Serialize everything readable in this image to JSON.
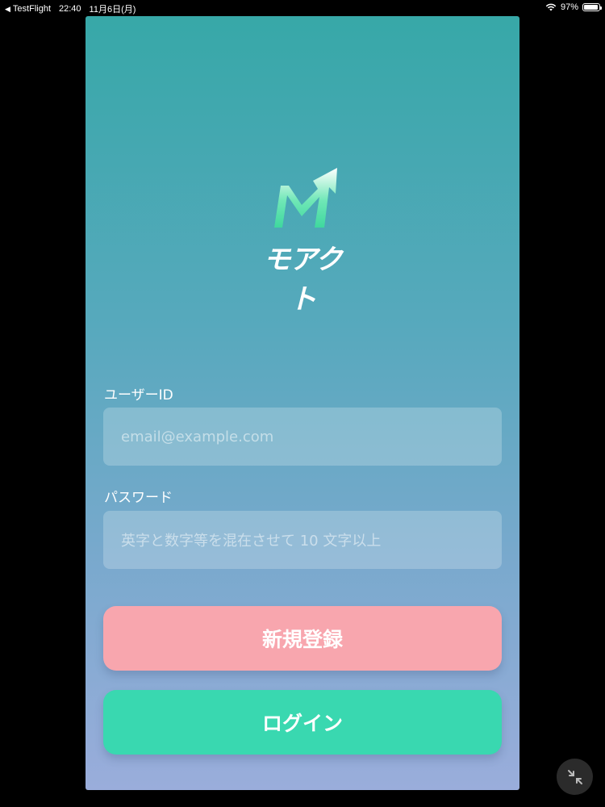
{
  "status_bar": {
    "back_app": "TestFlight",
    "time": "22:40",
    "date": "11月6日(月)",
    "battery": "97%",
    "battery_level": 0.97
  },
  "app": {
    "logo_text": "モアクト",
    "user_id": {
      "label": "ユーザーID",
      "placeholder": "email@example.com"
    },
    "password": {
      "label": "パスワード",
      "placeholder": "英字と数字等を混在させて 10 文字以上"
    },
    "register_button": "新規登録",
    "login_button": "ログイン"
  },
  "colors": {
    "gradient_top": "#37a8a8",
    "gradient_bottom": "#9aaddb",
    "register": "#f8a6ae",
    "login": "#39d8b0"
  }
}
